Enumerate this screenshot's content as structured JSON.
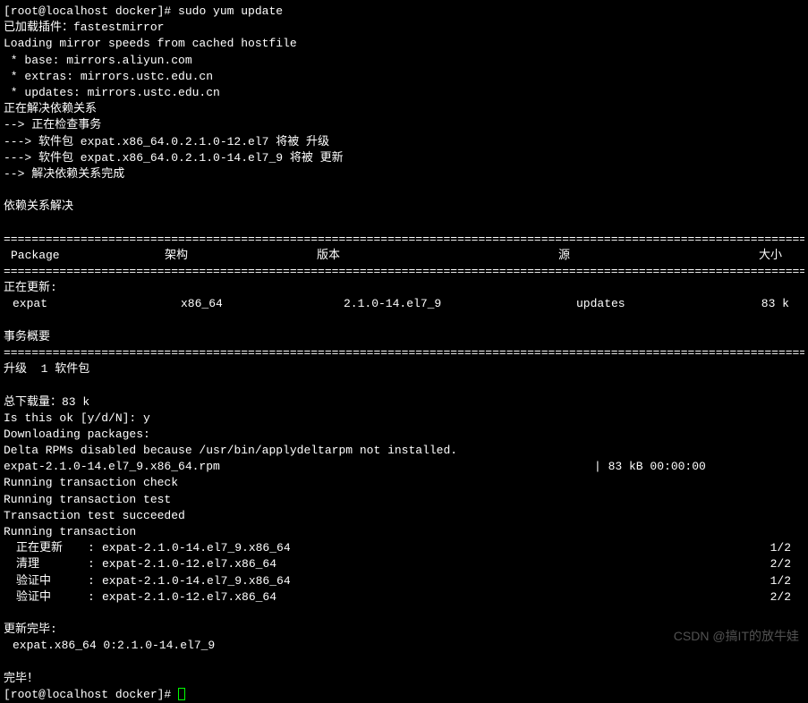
{
  "prompt1": "[root@localhost docker]# ",
  "command1": "sudo yum update",
  "lines_pre": [
    "已加载插件：fastestmirror",
    "Loading mirror speeds from cached hostfile",
    " * base: mirrors.aliyun.com",
    " * extras: mirrors.ustc.edu.cn",
    " * updates: mirrors.ustc.edu.cn",
    "正在解决依赖关系",
    "--> 正在检查事务",
    "---> 软件包 expat.x86_64.0.2.1.0-12.el7 将被 升级",
    "---> 软件包 expat.x86_64.0.2.1.0-14.el7_9 将被 更新",
    "--> 解决依赖关系完成",
    "",
    "依赖关系解决",
    ""
  ],
  "divider": "=======================================================================================================================",
  "headers": {
    "package": "Package",
    "arch": "架构",
    "version": "版本",
    "source": "源",
    "size": "大小"
  },
  "updating_label": "正在更新:",
  "row": {
    "package": "expat",
    "arch": "x86_64",
    "version": "2.1.0-14.el7_9",
    "source": "updates",
    "size": "83 k"
  },
  "summary_label": "事务概要",
  "upgrade_label": "升级  1 软件包",
  "total_label": "总下载量：83 k",
  "confirm_prompt": "Is this ok [y/d/N]: ",
  "confirm_answer": "y",
  "downloading": "Downloading packages:",
  "delta_msg": "Delta RPMs disabled because /usr/bin/applydeltarpm not installed.",
  "rpm_file": "expat-2.1.0-14.el7_9.x86_64.rpm",
  "rpm_progress": "|  83 kB  00:00:00",
  "run_check": "Running transaction check",
  "run_test": "Running transaction test",
  "test_ok": "Transaction test succeeded",
  "run_trans": "Running transaction",
  "trans": [
    {
      "action": "正在更新",
      "pkg": "expat-2.1.0-14.el7_9.x86_64",
      "count": "1/2"
    },
    {
      "action": "清理",
      "pkg": "expat-2.1.0-12.el7.x86_64",
      "count": "2/2"
    },
    {
      "action": "验证中",
      "pkg": "expat-2.1.0-14.el7_9.x86_64",
      "count": "1/2"
    },
    {
      "action": "验证中",
      "pkg": "expat-2.1.0-12.el7.x86_64",
      "count": "2/2"
    }
  ],
  "updated_label": "更新完毕:",
  "updated_pkg": "expat.x86_64 0:2.1.0-14.el7_9",
  "done": "完毕！",
  "prompt2": "[root@localhost docker]# ",
  "watermark": "CSDN @搞IT的放牛娃"
}
